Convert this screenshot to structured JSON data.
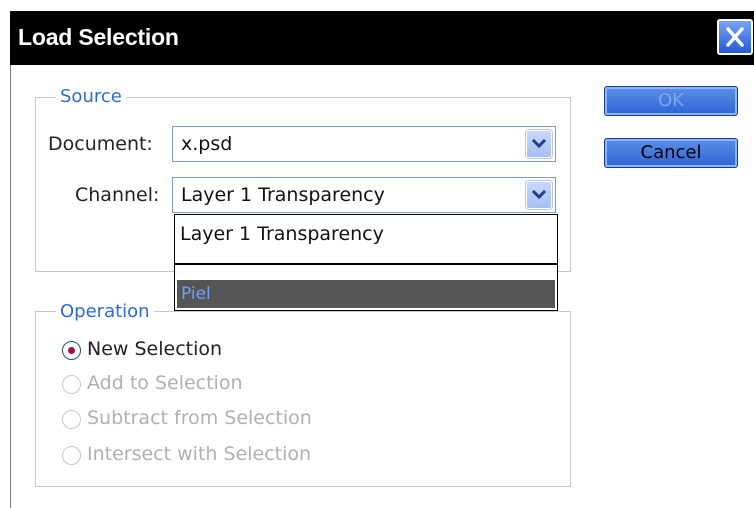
{
  "window": {
    "title": "Load Selection"
  },
  "source": {
    "legend": "Source",
    "document_label": "Document:",
    "document_value": "x.psd",
    "channel_label": "Channel:",
    "channel_value": "Layer 1 Transparency",
    "channel_options": [
      "Layer 1 Transparency",
      "Piel"
    ],
    "channel_highlighted": "Piel"
  },
  "operation": {
    "legend": "Operation",
    "options": [
      {
        "label": "New Selection",
        "checked": true,
        "enabled": true
      },
      {
        "label": "Add to Selection",
        "checked": false,
        "enabled": false
      },
      {
        "label": "Subtract from Selection",
        "checked": false,
        "enabled": false
      },
      {
        "label": "Intersect with Selection",
        "checked": false,
        "enabled": false
      }
    ]
  },
  "buttons": {
    "ok": "OK",
    "cancel": "Cancel"
  },
  "colors": {
    "titlebar": "#000000",
    "accent": "#2c6bd8",
    "button": "#3a6fdc",
    "highlight": "#555555",
    "highlight_text": "#6aa0ff"
  }
}
